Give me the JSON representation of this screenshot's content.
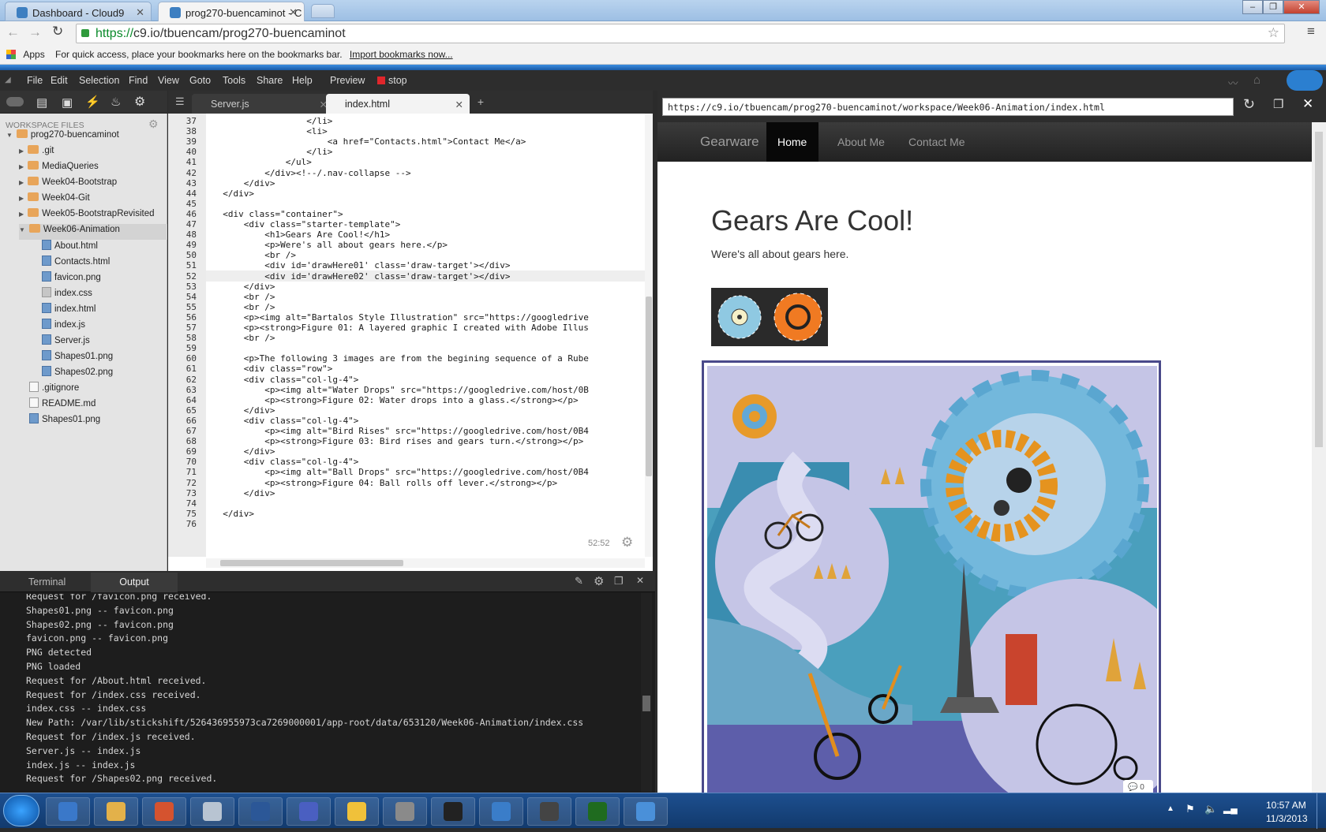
{
  "browser": {
    "tabs": [
      {
        "title": "Dashboard - Cloud9"
      },
      {
        "title": "prog270-buencaminot - C"
      }
    ],
    "url_scheme": "https://",
    "url_rest": "c9.io/tbuencam/prog270-buencaminot",
    "bookmarks": {
      "apps": "Apps",
      "hint": "For quick access, place your bookmarks here on the bookmarks bar.",
      "import_link": "Import bookmarks now..."
    }
  },
  "ide": {
    "menu": [
      "File",
      "Edit",
      "Selection",
      "Find",
      "View",
      "Goto",
      "Tools",
      "Share",
      "Help"
    ],
    "preview_label": "Preview",
    "stop_label": "stop",
    "workspace_label": "WORKSPACE FILES",
    "tree": [
      {
        "label": "prog270-buencaminot",
        "type": "folder",
        "indent": 0,
        "arrow": "▼"
      },
      {
        "label": ".git",
        "type": "folder",
        "indent": 1,
        "arrow": "▶"
      },
      {
        "label": "MediaQueries",
        "type": "folder",
        "indent": 1,
        "arrow": "▶"
      },
      {
        "label": "Week04-Bootstrap",
        "type": "folder",
        "indent": 1,
        "arrow": "▶"
      },
      {
        "label": "Week04-Git",
        "type": "folder",
        "indent": 1,
        "arrow": "▶"
      },
      {
        "label": "Week05-BootstrapRevisited",
        "type": "folder",
        "indent": 1,
        "arrow": "▶"
      },
      {
        "label": "Week06-Animation",
        "type": "folder",
        "indent": 1,
        "arrow": "▼"
      },
      {
        "label": "About.html",
        "type": "file",
        "indent": 2
      },
      {
        "label": "Contacts.html",
        "type": "file",
        "indent": 2
      },
      {
        "label": "favicon.png",
        "type": "file",
        "indent": 2
      },
      {
        "label": "index.css",
        "type": "css",
        "indent": 2
      },
      {
        "label": "index.html",
        "type": "file",
        "indent": 2
      },
      {
        "label": "index.js",
        "type": "file",
        "indent": 2
      },
      {
        "label": "Server.js",
        "type": "file",
        "indent": 2
      },
      {
        "label": "Shapes01.png",
        "type": "file",
        "indent": 2
      },
      {
        "label": "Shapes02.png",
        "type": "file",
        "indent": 2
      },
      {
        "label": ".gitignore",
        "type": "txt",
        "indent": 1
      },
      {
        "label": "README.md",
        "type": "txt",
        "indent": 1
      },
      {
        "label": "Shapes01.png",
        "type": "file",
        "indent": 1
      }
    ],
    "editor_tabs": [
      {
        "label": "Server.js",
        "active": false
      },
      {
        "label": "index.html",
        "active": true
      }
    ],
    "code_lines": [
      {
        "n": "37",
        "text": "                  </li>"
      },
      {
        "n": "38",
        "text": "                  <li>"
      },
      {
        "n": "39",
        "text": "                      <a href=\"Contacts.html\">Contact Me</a>"
      },
      {
        "n": "40",
        "text": "                  </li>"
      },
      {
        "n": "41",
        "text": "              </ul>"
      },
      {
        "n": "42",
        "text": "          </div><!--/.nav-collapse -->"
      },
      {
        "n": "43",
        "text": "      </div>"
      },
      {
        "n": "44",
        "text": "  </div>"
      },
      {
        "n": "45",
        "text": ""
      },
      {
        "n": "46",
        "text": "  <div class=\"container\">"
      },
      {
        "n": "47",
        "text": "      <div class=\"starter-template\">"
      },
      {
        "n": "48",
        "text": "          <h1>Gears Are Cool!</h1>"
      },
      {
        "n": "49",
        "text": "          <p>Were's all about gears here.</p>"
      },
      {
        "n": "50",
        "text": "          <br />"
      },
      {
        "n": "51",
        "text": "          <div id='drawHere01' class='draw-target'></div>"
      },
      {
        "n": "52",
        "text": "          <div id='drawHere02' class='draw-target'></div>"
      },
      {
        "n": "53",
        "text": "      </div>"
      },
      {
        "n": "54",
        "text": "      <br />"
      },
      {
        "n": "55",
        "text": "      <br />"
      },
      {
        "n": "56",
        "text": "      <p><img alt=\"Bartalos Style Illustration\" src=\"https://googledrive"
      },
      {
        "n": "57",
        "text": "      <p><strong>Figure 01: A layered graphic I created with Adobe Illus"
      },
      {
        "n": "58",
        "text": "      <br />"
      },
      {
        "n": "59",
        "text": ""
      },
      {
        "n": "60",
        "text": "      <p>The following 3 images are from the begining sequence of a Rube"
      },
      {
        "n": "61",
        "text": "      <div class=\"row\">"
      },
      {
        "n": "62",
        "text": "      <div class=\"col-lg-4\">"
      },
      {
        "n": "63",
        "text": "          <p><img alt=\"Water Drops\" src=\"https://googledrive.com/host/0B"
      },
      {
        "n": "64",
        "text": "          <p><strong>Figure 02: Water drops into a glass.</strong></p>"
      },
      {
        "n": "65",
        "text": "      </div>"
      },
      {
        "n": "66",
        "text": "      <div class=\"col-lg-4\">"
      },
      {
        "n": "67",
        "text": "          <p><img alt=\"Bird Rises\" src=\"https://googledrive.com/host/0B4"
      },
      {
        "n": "68",
        "text": "          <p><strong>Figure 03: Bird rises and gears turn.</strong></p>"
      },
      {
        "n": "69",
        "text": "      </div>"
      },
      {
        "n": "70",
        "text": "      <div class=\"col-lg-4\">"
      },
      {
        "n": "71",
        "text": "          <p><img alt=\"Ball Drops\" src=\"https://googledrive.com/host/0B4"
      },
      {
        "n": "72",
        "text": "          <p><strong>Figure 04: Ball rolls off lever.</strong></p>"
      },
      {
        "n": "73",
        "text": "      </div>"
      },
      {
        "n": "74",
        "text": ""
      },
      {
        "n": "75",
        "text": "  </div>"
      },
      {
        "n": "76",
        "text": ""
      }
    ],
    "highlight_line": "52",
    "cursor_pos": "52:52",
    "bottom_tabs": [
      "Terminal",
      "Output"
    ],
    "output_lines": [
      "Request for /favicon.png received.",
      "Shapes01.png -- favicon.png",
      "Shapes02.png -- favicon.png",
      "favicon.png -- favicon.png",
      "PNG detected",
      "PNG loaded",
      "Request for /About.html received.",
      "Request for /index.css received.",
      "index.css -- index.css",
      "New Path: /var/lib/stickshift/526436955973ca7269000001/app-root/data/653120/Week06-Animation/index.css",
      "Request for /index.js received.",
      "Server.js -- index.js",
      "index.js -- index.js",
      "Request for /Shapes02.png received."
    ]
  },
  "preview": {
    "url": "https://c9.io/tbuencam/prog270-buencaminot/workspace/Week06-Animation/index.html",
    "brand": "Gearware",
    "nav": [
      "Home",
      "About Me",
      "Contact Me"
    ],
    "heading": "Gears Are Cool!",
    "subtext": "Were's all about gears here.",
    "comment_count": "0"
  },
  "taskbar": {
    "time": "10:57 AM",
    "date": "11/3/2013",
    "apps": [
      "windows-start",
      "internet-explorer",
      "file-explorer",
      "media-player",
      "paint-tool",
      "word",
      "infinity-app",
      "chrome",
      "pixel-tool",
      "command-prompt",
      "text-tool",
      "feather-app",
      "dreamweaver",
      "blue-app"
    ]
  },
  "colors": {
    "ide_bg": "#2d2d2d",
    "file_panel": "#e4e4e4",
    "folder": "#e8a55a",
    "output_bg": "#1d1d1d",
    "navbar": "#222222",
    "taskbar": "#1d4f8f",
    "illus_bg": "#c5c5e6",
    "illus_teal": "#4a9fbd"
  }
}
